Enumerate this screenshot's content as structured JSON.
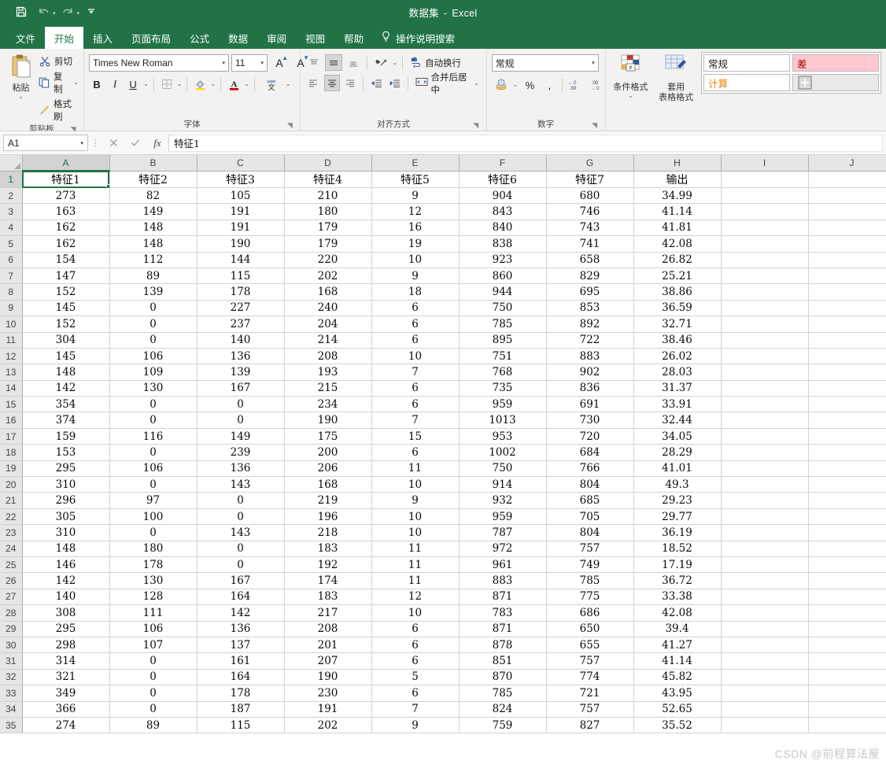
{
  "titlebar": {
    "doc_title": "数据集",
    "separator": "-",
    "app_name": "Excel",
    "qat": [
      {
        "name": "save-icon",
        "label": "保存"
      },
      {
        "name": "undo-icon",
        "label": "撤消"
      },
      {
        "name": "redo-icon",
        "label": "恢复"
      },
      {
        "name": "customize-qat-icon",
        "label": "自定义快速访问工具栏"
      }
    ]
  },
  "tabs": [
    {
      "label": "文件",
      "active": false
    },
    {
      "label": "开始",
      "active": true
    },
    {
      "label": "插入",
      "active": false
    },
    {
      "label": "页面布局",
      "active": false
    },
    {
      "label": "公式",
      "active": false
    },
    {
      "label": "数据",
      "active": false
    },
    {
      "label": "审阅",
      "active": false
    },
    {
      "label": "视图",
      "active": false
    },
    {
      "label": "帮助",
      "active": false
    }
  ],
  "tellme": {
    "icon": "lightbulb-icon",
    "label": "操作说明搜索"
  },
  "ribbon": {
    "clipboard": {
      "group_label": "剪贴板",
      "paste_label": "粘贴",
      "cut_label": "剪切",
      "copy_label": "复制",
      "format_painter_label": "格式刷"
    },
    "font": {
      "group_label": "字体",
      "font_name": "Times New Roman",
      "font_size": "11",
      "grow_label": "A",
      "shrink_label": "A",
      "bold_label": "B",
      "italic_label": "I",
      "underline_label": "U",
      "phonetic_label": "wén 文"
    },
    "alignment": {
      "group_label": "对齐方式",
      "wrap_text_label": "自动换行",
      "merge_center_label": "合并后居中"
    },
    "number": {
      "group_label": "数字",
      "format_value": "常规",
      "percent_label": "%",
      "comma_label": ","
    },
    "styles": {
      "conditional_label_l1": "条件格式",
      "table_label_l1": "套用",
      "table_label_l2": "表格格式",
      "cell_style_normal": "常规",
      "cell_style_calc": "计算",
      "cell_style_bad": "差"
    }
  },
  "formula_bar": {
    "name_box": "A1",
    "cancel_icon": "close-icon",
    "confirm_icon": "check-icon",
    "fx_label": "fx",
    "content": "特征1"
  },
  "grid": {
    "columns": [
      "A",
      "B",
      "C",
      "D",
      "E",
      "F",
      "G",
      "H",
      "I",
      "J"
    ],
    "selected_column": "A",
    "selected_row": 1,
    "active_cell": "A1",
    "header_row": [
      "特征1",
      "特征2",
      "特征3",
      "特征4",
      "特征5",
      "特征6",
      "特征7",
      "输出"
    ],
    "rows": [
      {
        "n": 2,
        "v": [
          "273",
          "82",
          "105",
          "210",
          "9",
          "904",
          "680",
          "34.99"
        ]
      },
      {
        "n": 3,
        "v": [
          "163",
          "149",
          "191",
          "180",
          "12",
          "843",
          "746",
          "41.14"
        ]
      },
      {
        "n": 4,
        "v": [
          "162",
          "148",
          "191",
          "179",
          "16",
          "840",
          "743",
          "41.81"
        ]
      },
      {
        "n": 5,
        "v": [
          "162",
          "148",
          "190",
          "179",
          "19",
          "838",
          "741",
          "42.08"
        ]
      },
      {
        "n": 6,
        "v": [
          "154",
          "112",
          "144",
          "220",
          "10",
          "923",
          "658",
          "26.82"
        ]
      },
      {
        "n": 7,
        "v": [
          "147",
          "89",
          "115",
          "202",
          "9",
          "860",
          "829",
          "25.21"
        ]
      },
      {
        "n": 8,
        "v": [
          "152",
          "139",
          "178",
          "168",
          "18",
          "944",
          "695",
          "38.86"
        ]
      },
      {
        "n": 9,
        "v": [
          "145",
          "0",
          "227",
          "240",
          "6",
          "750",
          "853",
          "36.59"
        ]
      },
      {
        "n": 10,
        "v": [
          "152",
          "0",
          "237",
          "204",
          "6",
          "785",
          "892",
          "32.71"
        ]
      },
      {
        "n": 11,
        "v": [
          "304",
          "0",
          "140",
          "214",
          "6",
          "895",
          "722",
          "38.46"
        ]
      },
      {
        "n": 12,
        "v": [
          "145",
          "106",
          "136",
          "208",
          "10",
          "751",
          "883",
          "26.02"
        ]
      },
      {
        "n": 13,
        "v": [
          "148",
          "109",
          "139",
          "193",
          "7",
          "768",
          "902",
          "28.03"
        ]
      },
      {
        "n": 14,
        "v": [
          "142",
          "130",
          "167",
          "215",
          "6",
          "735",
          "836",
          "31.37"
        ]
      },
      {
        "n": 15,
        "v": [
          "354",
          "0",
          "0",
          "234",
          "6",
          "959",
          "691",
          "33.91"
        ]
      },
      {
        "n": 16,
        "v": [
          "374",
          "0",
          "0",
          "190",
          "7",
          "1013",
          "730",
          "32.44"
        ]
      },
      {
        "n": 17,
        "v": [
          "159",
          "116",
          "149",
          "175",
          "15",
          "953",
          "720",
          "34.05"
        ]
      },
      {
        "n": 18,
        "v": [
          "153",
          "0",
          "239",
          "200",
          "6",
          "1002",
          "684",
          "28.29"
        ]
      },
      {
        "n": 19,
        "v": [
          "295",
          "106",
          "136",
          "206",
          "11",
          "750",
          "766",
          "41.01"
        ]
      },
      {
        "n": 20,
        "v": [
          "310",
          "0",
          "143",
          "168",
          "10",
          "914",
          "804",
          "49.3"
        ]
      },
      {
        "n": 21,
        "v": [
          "296",
          "97",
          "0",
          "219",
          "9",
          "932",
          "685",
          "29.23"
        ]
      },
      {
        "n": 22,
        "v": [
          "305",
          "100",
          "0",
          "196",
          "10",
          "959",
          "705",
          "29.77"
        ]
      },
      {
        "n": 23,
        "v": [
          "310",
          "0",
          "143",
          "218",
          "10",
          "787",
          "804",
          "36.19"
        ]
      },
      {
        "n": 24,
        "v": [
          "148",
          "180",
          "0",
          "183",
          "11",
          "972",
          "757",
          "18.52"
        ]
      },
      {
        "n": 25,
        "v": [
          "146",
          "178",
          "0",
          "192",
          "11",
          "961",
          "749",
          "17.19"
        ]
      },
      {
        "n": 26,
        "v": [
          "142",
          "130",
          "167",
          "174",
          "11",
          "883",
          "785",
          "36.72"
        ]
      },
      {
        "n": 27,
        "v": [
          "140",
          "128",
          "164",
          "183",
          "12",
          "871",
          "775",
          "33.38"
        ]
      },
      {
        "n": 28,
        "v": [
          "308",
          "111",
          "142",
          "217",
          "10",
          "783",
          "686",
          "42.08"
        ]
      },
      {
        "n": 29,
        "v": [
          "295",
          "106",
          "136",
          "208",
          "6",
          "871",
          "650",
          "39.4"
        ]
      },
      {
        "n": 30,
        "v": [
          "298",
          "107",
          "137",
          "201",
          "6",
          "878",
          "655",
          "41.27"
        ]
      },
      {
        "n": 31,
        "v": [
          "314",
          "0",
          "161",
          "207",
          "6",
          "851",
          "757",
          "41.14"
        ]
      },
      {
        "n": 32,
        "v": [
          "321",
          "0",
          "164",
          "190",
          "5",
          "870",
          "774",
          "45.82"
        ]
      },
      {
        "n": 33,
        "v": [
          "349",
          "0",
          "178",
          "230",
          "6",
          "785",
          "721",
          "43.95"
        ]
      },
      {
        "n": 34,
        "v": [
          "366",
          "0",
          "187",
          "191",
          "7",
          "824",
          "757",
          "52.65"
        ]
      },
      {
        "n": 35,
        "v": [
          "274",
          "89",
          "115",
          "202",
          "9",
          "759",
          "827",
          "35.52"
        ]
      }
    ]
  },
  "watermark": "CSDN @前程算法屋",
  "colors": {
    "excel_green": "#217346",
    "ribbon_bg": "#f3f2f1",
    "grid_line": "#d4d4d4",
    "header_bg": "#e6e6e6"
  }
}
